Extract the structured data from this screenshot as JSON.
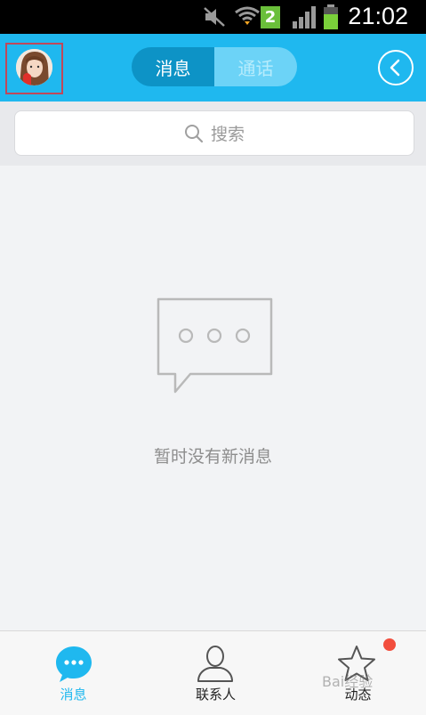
{
  "status_bar": {
    "time": "21:02",
    "notification_count": "2"
  },
  "header": {
    "tabs": [
      {
        "label": "消息",
        "active": true
      },
      {
        "label": "通话",
        "active": false
      }
    ]
  },
  "search": {
    "placeholder": "搜索"
  },
  "empty_state": {
    "text": "暂时没有新消息"
  },
  "bottom_nav": {
    "items": [
      {
        "label": "消息",
        "icon": "chat-bubble-icon",
        "active": true
      },
      {
        "label": "联系人",
        "icon": "person-icon",
        "active": false
      },
      {
        "label": "动态",
        "icon": "star-icon",
        "active": false,
        "badge": true
      }
    ]
  },
  "watermark": "Bai经验",
  "colors": {
    "accent": "#1fb8ef",
    "tab_active": "#0d93c6",
    "badge": "#f24e3d"
  }
}
